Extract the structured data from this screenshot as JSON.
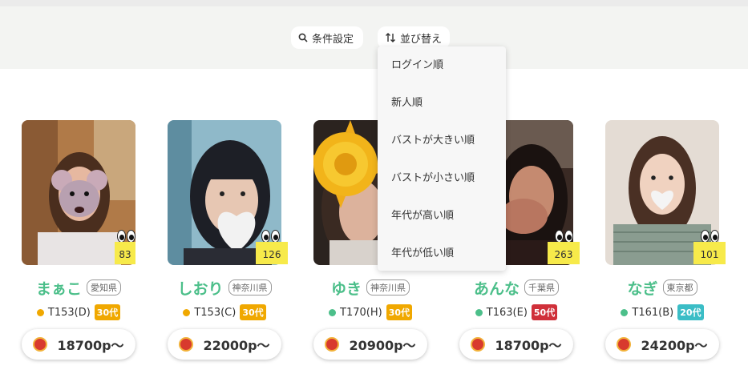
{
  "filter": {
    "conditions_label": "条件設定",
    "sort_label": "並び替え"
  },
  "sort_menu": {
    "items": [
      "ログイン順",
      "新人順",
      "バストが大きい順",
      "バストが小さい順",
      "年代が高い順",
      "年代が低い順"
    ]
  },
  "cards": [
    {
      "name": "まぁこ",
      "prefecture": "愛知県",
      "views": "83",
      "spec": "T153(D)",
      "age": "30代",
      "age_color": "#f0a800",
      "status_color": "#f0a800",
      "price": "18700p〜"
    },
    {
      "name": "しおり",
      "prefecture": "神奈川県",
      "views": "126",
      "spec": "T153(C)",
      "age": "30代",
      "age_color": "#f0a800",
      "status_color": "#f0a800",
      "price": "22000p〜"
    },
    {
      "name": "ゆき",
      "prefecture": "神奈川県",
      "views": "",
      "spec": "T170(H)",
      "age": "30代",
      "age_color": "#f0a800",
      "status_color": "#4cbf8a",
      "price": "20900p〜"
    },
    {
      "name": "あんな",
      "prefecture": "千葉県",
      "views": "263",
      "spec": "T163(E)",
      "age": "50代",
      "age_color": "#d0303a",
      "status_color": "#4cbf8a",
      "price": "18700p〜"
    },
    {
      "name": "なぎ",
      "prefecture": "東京都",
      "views": "101",
      "spec": "T161(B)",
      "age": "20代",
      "age_color": "#3bbdc6",
      "status_color": "#4cbf8a",
      "price": "24200p〜"
    }
  ]
}
